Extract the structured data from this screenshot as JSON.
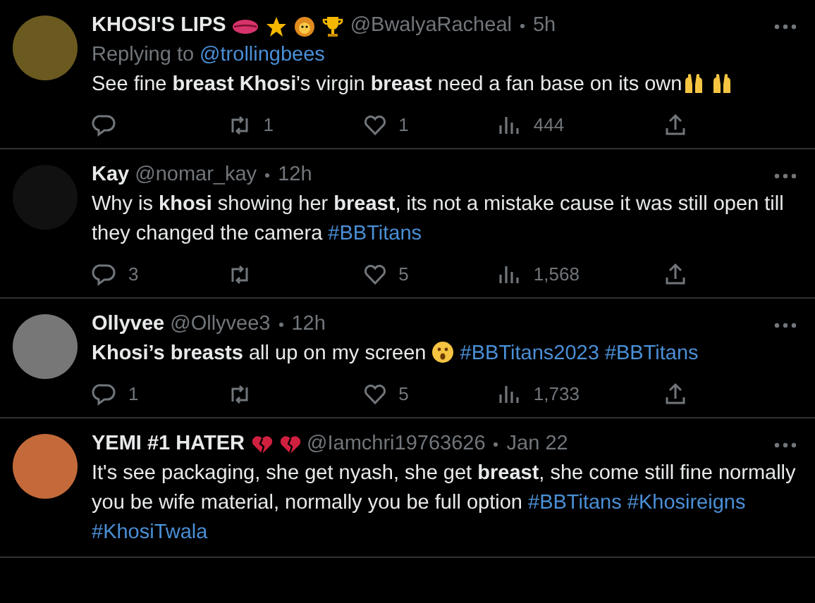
{
  "tweets": [
    {
      "name": "KHOSI'S LIPS",
      "badges": [
        {
          "kind": "lips"
        },
        {
          "kind": "star"
        },
        {
          "kind": "lion"
        },
        {
          "kind": "trophy"
        }
      ],
      "handle": "@BwalyaRacheal",
      "time": "5h",
      "reply_to": {
        "label": "Replying to",
        "user": "@trollingbees"
      },
      "body": [
        {
          "kind": "text",
          "text": "See fine **breast** **Khosi**'s virgin **breast** need a fan base on its own"
        },
        {
          "kind": "hands"
        },
        {
          "kind": "hands"
        }
      ],
      "actions": {
        "retweets": "1",
        "likes": "1",
        "views": "444"
      }
    },
    {
      "name": "Kay",
      "handle": "@nomar_kay",
      "time": "12h",
      "body": [
        {
          "kind": "text",
          "text": "Why is **khosi** showing her **breast**, its not a mistake cause it was still open till they changed the camera "
        },
        {
          "kind": "hashtag",
          "text": "#BBTitans"
        }
      ],
      "actions": {
        "replies": "3",
        "likes": "5",
        "views": "1,568"
      }
    },
    {
      "name": "Ollyvee",
      "handle": "@Ollyvee3",
      "time": "12h",
      "body": [
        {
          "kind": "text",
          "text": "**Khosi’s breasts** all up on my screen "
        },
        {
          "kind": "astonished"
        },
        {
          "kind": "hashtag",
          "text": "#BBTitans2023"
        },
        {
          "kind": "hashtag",
          "text": "#BBTitans"
        }
      ],
      "actions": {
        "replies": "1",
        "likes": "5",
        "views": "1,733"
      }
    },
    {
      "name": "YEMI #1 HATER",
      "badges": [
        {
          "kind": "heartbreak"
        },
        {
          "kind": "heartbreak"
        }
      ],
      "handle": "@Iamchri19763626",
      "time": "Jan 22",
      "body": [
        {
          "kind": "text",
          "text": "It's see packaging, she get nyash, she get **breast**, she come still fine normally you be wife material, normally you be full option "
        },
        {
          "kind": "hashtag",
          "text": "#BBTitans"
        },
        {
          "kind": "hashtag",
          "text": "#Khosireigns"
        },
        {
          "kind": "hashtag",
          "text": "#KhosiTwala"
        }
      ]
    }
  ]
}
